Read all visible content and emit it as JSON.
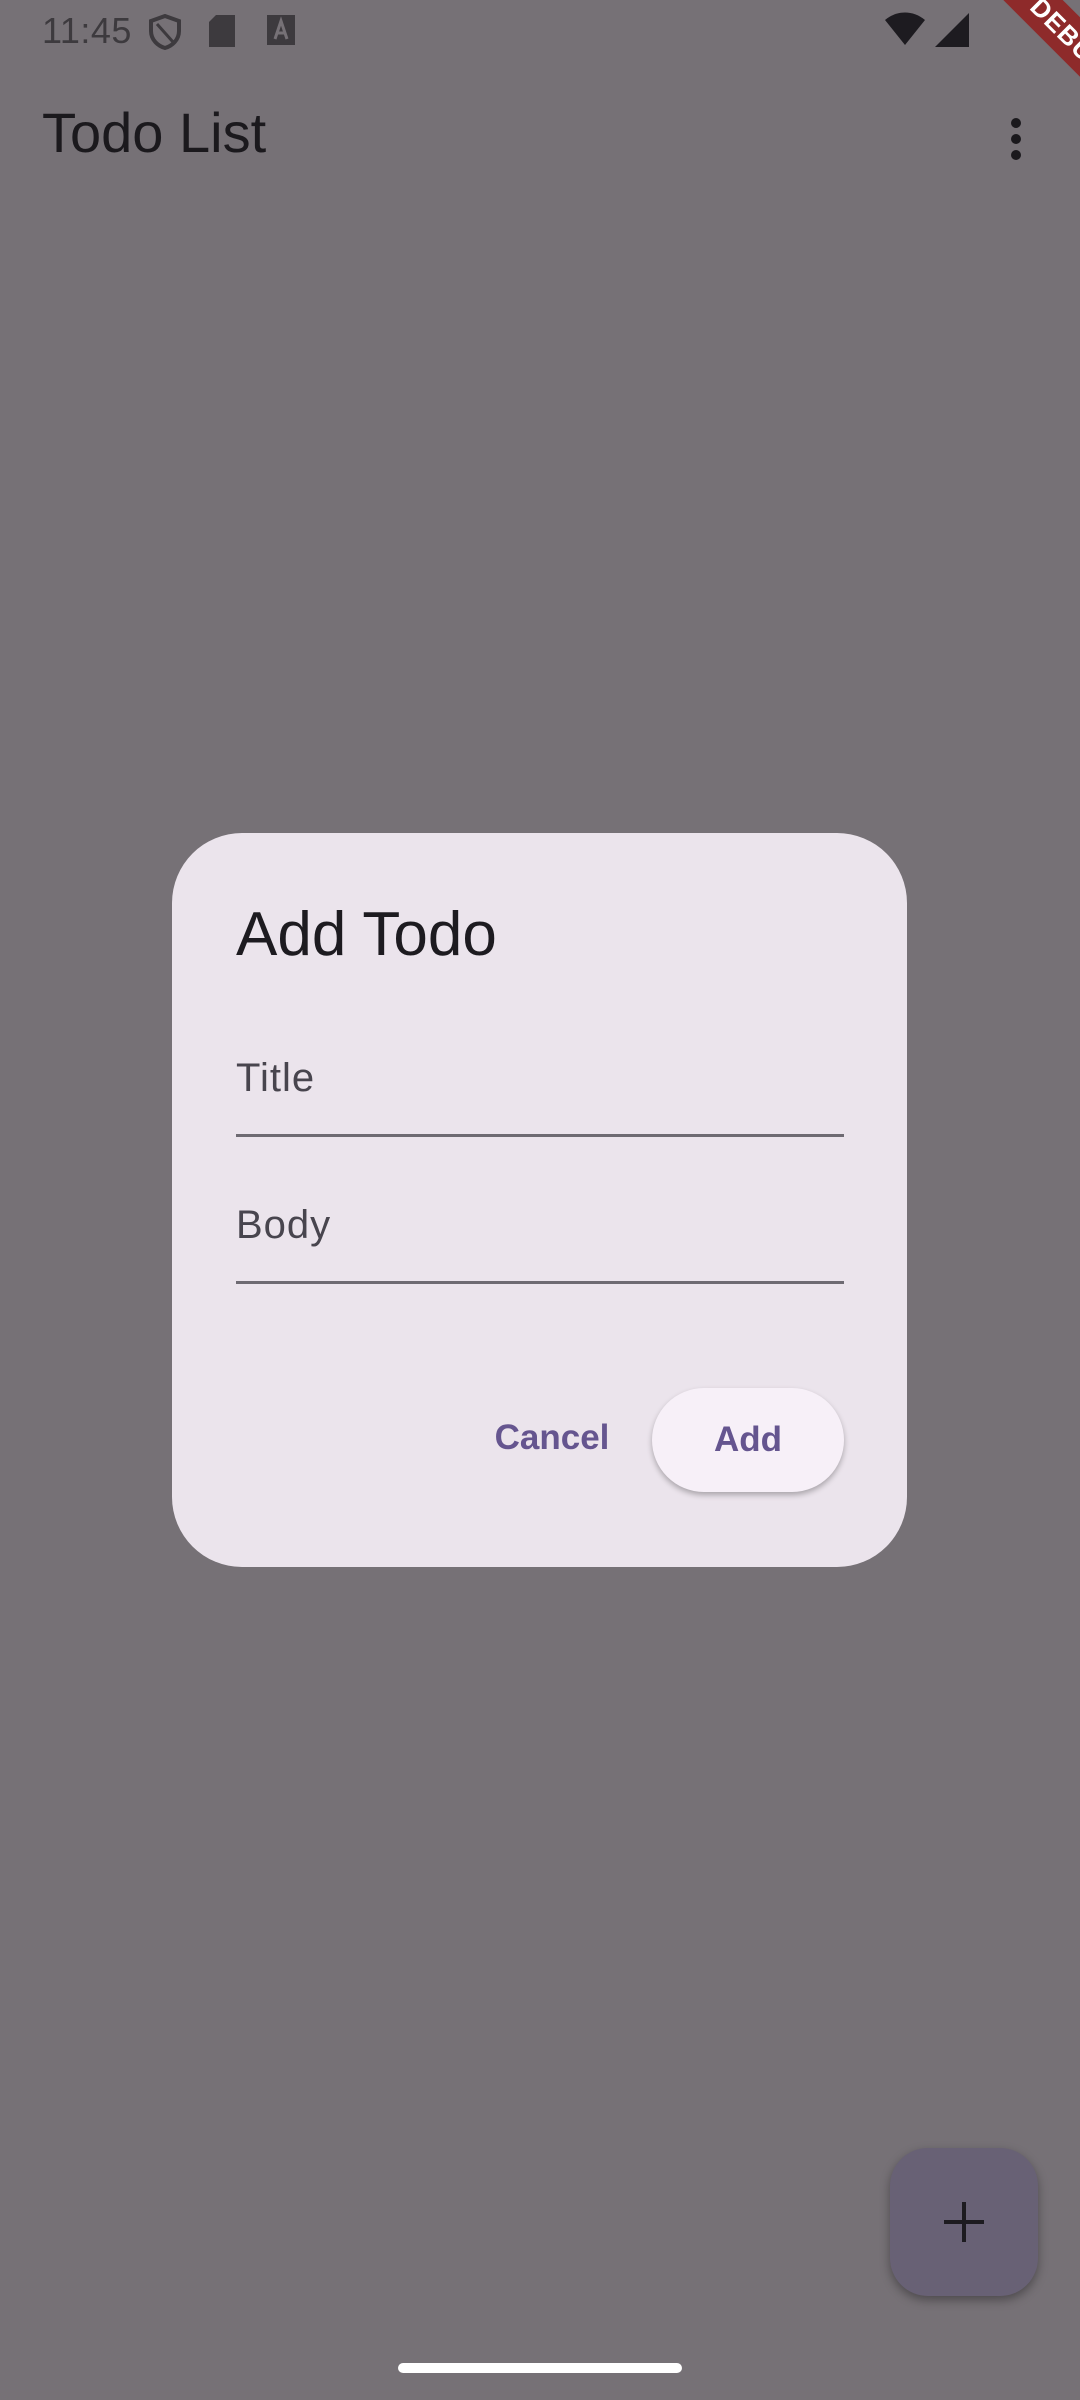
{
  "status_bar": {
    "time": "11:45",
    "left_icons": [
      "shield-icon",
      "sd-card-icon",
      "font-a-icon"
    ],
    "right_icons": [
      "wifi-icon",
      "signal-icon"
    ]
  },
  "app_bar": {
    "title": "Todo List",
    "menu_icon": "more-vert-icon"
  },
  "debug_banner": {
    "label": "DEBUG",
    "color": "#8e2a2a"
  },
  "dialog": {
    "title": "Add Todo",
    "fields": [
      {
        "label": "Title",
        "value": ""
      },
      {
        "label": "Body",
        "value": ""
      }
    ],
    "cancel_label": "Cancel",
    "add_label": "Add",
    "accent_color": "#65558f"
  },
  "fab": {
    "icon": "plus-icon"
  },
  "colors": {
    "scrim_background": "#767176",
    "dialog_surface": "#ebe4ec"
  }
}
